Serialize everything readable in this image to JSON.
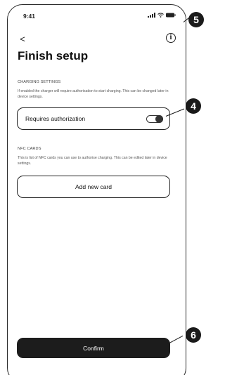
{
  "status_bar": {
    "time": "9:41",
    "icons": [
      "signal-icon",
      "wifi-icon",
      "battery-icon"
    ]
  },
  "nav": {
    "back_glyph": "<",
    "info_glyph": "i"
  },
  "title": "Finish setup",
  "charging": {
    "section_label": "CHARGING SETTINGS",
    "description": "If enabled the charger will require authorisation to start charging. This can be changed later in device settings.",
    "toggle_label": "Requires authorization",
    "toggle_on": false
  },
  "nfc": {
    "section_label": "NFC CARDS",
    "description": "This is list of NFC cards you can use to authorise charging. This can be edited later in device settings.",
    "add_button_label": "Add new card"
  },
  "confirm_label": "Confirm",
  "callouts": {
    "info": "5",
    "toggle": "4",
    "confirm": "6"
  },
  "colors": {
    "text": "#111111",
    "button_dark": "#1c1c1c",
    "callout": "#1a1a1a"
  }
}
